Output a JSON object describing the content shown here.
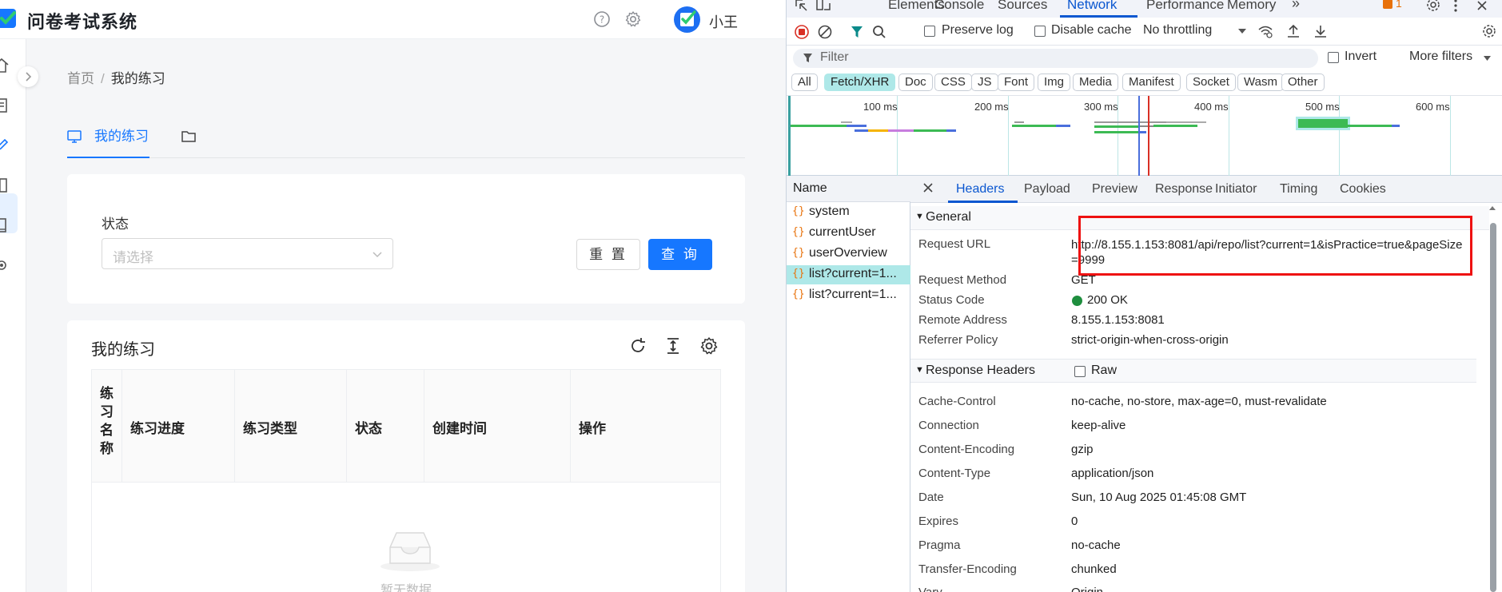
{
  "app": {
    "title": "问卷考试系统",
    "user_name": "小王",
    "breadcrumb": {
      "home": "首页",
      "separator": "/",
      "current": "我的练习"
    },
    "tab_label": "我的练习",
    "filter": {
      "status_label": "状态",
      "status_placeholder": "请选择",
      "reset_label": "重 置",
      "query_label": "查 询"
    },
    "list": {
      "title": "我的练习",
      "columns": [
        "练习名称",
        "练习进度",
        "练习类型",
        "状态",
        "创建时间",
        "操作"
      ],
      "empty_text": "暂无数据"
    },
    "colors": {
      "primary": "#1677ff"
    }
  },
  "devtools": {
    "panel_tabs": [
      "Elements",
      "Console",
      "Sources",
      "Network",
      "Performance",
      "Memory"
    ],
    "active_panel": "Network",
    "issues_count": "1",
    "toolbar": {
      "preserve_log": "Preserve log",
      "disable_cache": "Disable cache",
      "throttling": "No throttling"
    },
    "filter_placeholder": "Filter",
    "invert_label": "Invert",
    "more_filters": "More filters",
    "type_filters": [
      "All",
      "Fetch/XHR",
      "Doc",
      "CSS",
      "JS",
      "Font",
      "Img",
      "Media",
      "Manifest",
      "Socket",
      "Wasm",
      "Other"
    ],
    "active_type_filter": "Fetch/XHR",
    "timeline_labels": [
      "100 ms",
      "200 ms",
      "300 ms",
      "400 ms",
      "500 ms",
      "600 ms"
    ],
    "name_header": "Name",
    "requests": [
      "system",
      "currentUser",
      "userOverview",
      "list?current=1...",
      "list?current=1..."
    ],
    "selected_request_index": 3,
    "detail_tabs": [
      "Headers",
      "Payload",
      "Preview",
      "Response",
      "Initiator",
      "Timing",
      "Cookies"
    ],
    "general_section": "General",
    "general": [
      {
        "key": "Request URL",
        "value": "http://8.155.1.153:8081/api/repo/list?current=1&isPractice=true&pageSize=9999"
      },
      {
        "key": "Request Method",
        "value": "GET"
      },
      {
        "key": "Status Code",
        "value": "200 OK"
      },
      {
        "key": "Remote Address",
        "value": "8.155.1.153:8081"
      },
      {
        "key": "Referrer Policy",
        "value": "strict-origin-when-cross-origin"
      }
    ],
    "response_section": "Response Headers",
    "raw_label": "Raw",
    "response_headers": [
      {
        "key": "Cache-Control",
        "value": "no-cache, no-store, max-age=0, must-revalidate"
      },
      {
        "key": "Connection",
        "value": "keep-alive"
      },
      {
        "key": "Content-Encoding",
        "value": "gzip"
      },
      {
        "key": "Content-Type",
        "value": "application/json"
      },
      {
        "key": "Date",
        "value": "Sun, 10 Aug 2025 01:45:08 GMT"
      },
      {
        "key": "Expires",
        "value": "0"
      },
      {
        "key": "Pragma",
        "value": "no-cache"
      },
      {
        "key": "Transfer-Encoding",
        "value": "chunked"
      },
      {
        "key": "Vary",
        "value": "Origin"
      }
    ],
    "colors": {
      "accent": "#0b57d0",
      "status_ok": "#1e8e3e",
      "highlight_box": "#ee1111"
    }
  }
}
